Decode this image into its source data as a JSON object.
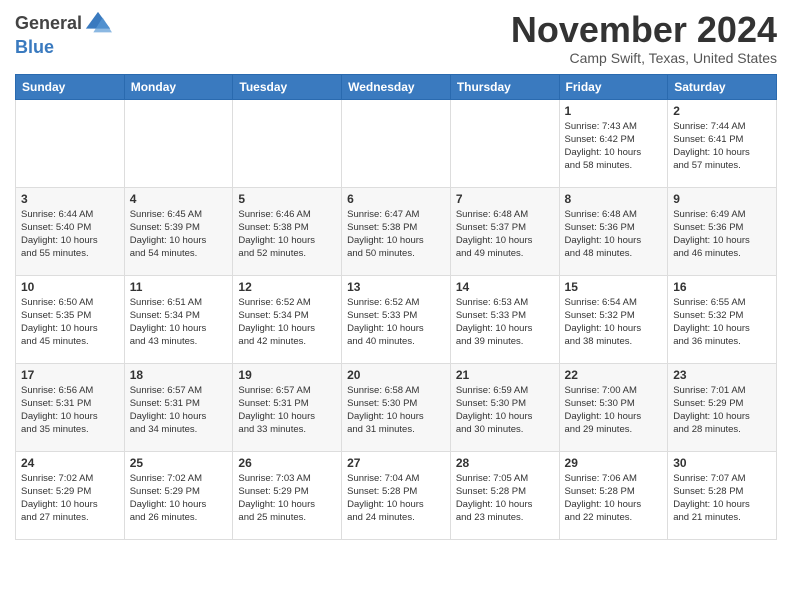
{
  "header": {
    "logo_general": "General",
    "logo_blue": "Blue",
    "month_title": "November 2024",
    "location": "Camp Swift, Texas, United States"
  },
  "weekdays": [
    "Sunday",
    "Monday",
    "Tuesday",
    "Wednesday",
    "Thursday",
    "Friday",
    "Saturday"
  ],
  "weeks": [
    [
      {
        "day": "",
        "info": ""
      },
      {
        "day": "",
        "info": ""
      },
      {
        "day": "",
        "info": ""
      },
      {
        "day": "",
        "info": ""
      },
      {
        "day": "",
        "info": ""
      },
      {
        "day": "1",
        "info": "Sunrise: 7:43 AM\nSunset: 6:42 PM\nDaylight: 10 hours\nand 58 minutes."
      },
      {
        "day": "2",
        "info": "Sunrise: 7:44 AM\nSunset: 6:41 PM\nDaylight: 10 hours\nand 57 minutes."
      }
    ],
    [
      {
        "day": "3",
        "info": "Sunrise: 6:44 AM\nSunset: 5:40 PM\nDaylight: 10 hours\nand 55 minutes."
      },
      {
        "day": "4",
        "info": "Sunrise: 6:45 AM\nSunset: 5:39 PM\nDaylight: 10 hours\nand 54 minutes."
      },
      {
        "day": "5",
        "info": "Sunrise: 6:46 AM\nSunset: 5:38 PM\nDaylight: 10 hours\nand 52 minutes."
      },
      {
        "day": "6",
        "info": "Sunrise: 6:47 AM\nSunset: 5:38 PM\nDaylight: 10 hours\nand 50 minutes."
      },
      {
        "day": "7",
        "info": "Sunrise: 6:48 AM\nSunset: 5:37 PM\nDaylight: 10 hours\nand 49 minutes."
      },
      {
        "day": "8",
        "info": "Sunrise: 6:48 AM\nSunset: 5:36 PM\nDaylight: 10 hours\nand 48 minutes."
      },
      {
        "day": "9",
        "info": "Sunrise: 6:49 AM\nSunset: 5:36 PM\nDaylight: 10 hours\nand 46 minutes."
      }
    ],
    [
      {
        "day": "10",
        "info": "Sunrise: 6:50 AM\nSunset: 5:35 PM\nDaylight: 10 hours\nand 45 minutes."
      },
      {
        "day": "11",
        "info": "Sunrise: 6:51 AM\nSunset: 5:34 PM\nDaylight: 10 hours\nand 43 minutes."
      },
      {
        "day": "12",
        "info": "Sunrise: 6:52 AM\nSunset: 5:34 PM\nDaylight: 10 hours\nand 42 minutes."
      },
      {
        "day": "13",
        "info": "Sunrise: 6:52 AM\nSunset: 5:33 PM\nDaylight: 10 hours\nand 40 minutes."
      },
      {
        "day": "14",
        "info": "Sunrise: 6:53 AM\nSunset: 5:33 PM\nDaylight: 10 hours\nand 39 minutes."
      },
      {
        "day": "15",
        "info": "Sunrise: 6:54 AM\nSunset: 5:32 PM\nDaylight: 10 hours\nand 38 minutes."
      },
      {
        "day": "16",
        "info": "Sunrise: 6:55 AM\nSunset: 5:32 PM\nDaylight: 10 hours\nand 36 minutes."
      }
    ],
    [
      {
        "day": "17",
        "info": "Sunrise: 6:56 AM\nSunset: 5:31 PM\nDaylight: 10 hours\nand 35 minutes."
      },
      {
        "day": "18",
        "info": "Sunrise: 6:57 AM\nSunset: 5:31 PM\nDaylight: 10 hours\nand 34 minutes."
      },
      {
        "day": "19",
        "info": "Sunrise: 6:57 AM\nSunset: 5:31 PM\nDaylight: 10 hours\nand 33 minutes."
      },
      {
        "day": "20",
        "info": "Sunrise: 6:58 AM\nSunset: 5:30 PM\nDaylight: 10 hours\nand 31 minutes."
      },
      {
        "day": "21",
        "info": "Sunrise: 6:59 AM\nSunset: 5:30 PM\nDaylight: 10 hours\nand 30 minutes."
      },
      {
        "day": "22",
        "info": "Sunrise: 7:00 AM\nSunset: 5:30 PM\nDaylight: 10 hours\nand 29 minutes."
      },
      {
        "day": "23",
        "info": "Sunrise: 7:01 AM\nSunset: 5:29 PM\nDaylight: 10 hours\nand 28 minutes."
      }
    ],
    [
      {
        "day": "24",
        "info": "Sunrise: 7:02 AM\nSunset: 5:29 PM\nDaylight: 10 hours\nand 27 minutes."
      },
      {
        "day": "25",
        "info": "Sunrise: 7:02 AM\nSunset: 5:29 PM\nDaylight: 10 hours\nand 26 minutes."
      },
      {
        "day": "26",
        "info": "Sunrise: 7:03 AM\nSunset: 5:29 PM\nDaylight: 10 hours\nand 25 minutes."
      },
      {
        "day": "27",
        "info": "Sunrise: 7:04 AM\nSunset: 5:28 PM\nDaylight: 10 hours\nand 24 minutes."
      },
      {
        "day": "28",
        "info": "Sunrise: 7:05 AM\nSunset: 5:28 PM\nDaylight: 10 hours\nand 23 minutes."
      },
      {
        "day": "29",
        "info": "Sunrise: 7:06 AM\nSunset: 5:28 PM\nDaylight: 10 hours\nand 22 minutes."
      },
      {
        "day": "30",
        "info": "Sunrise: 7:07 AM\nSunset: 5:28 PM\nDaylight: 10 hours\nand 21 minutes."
      }
    ]
  ]
}
